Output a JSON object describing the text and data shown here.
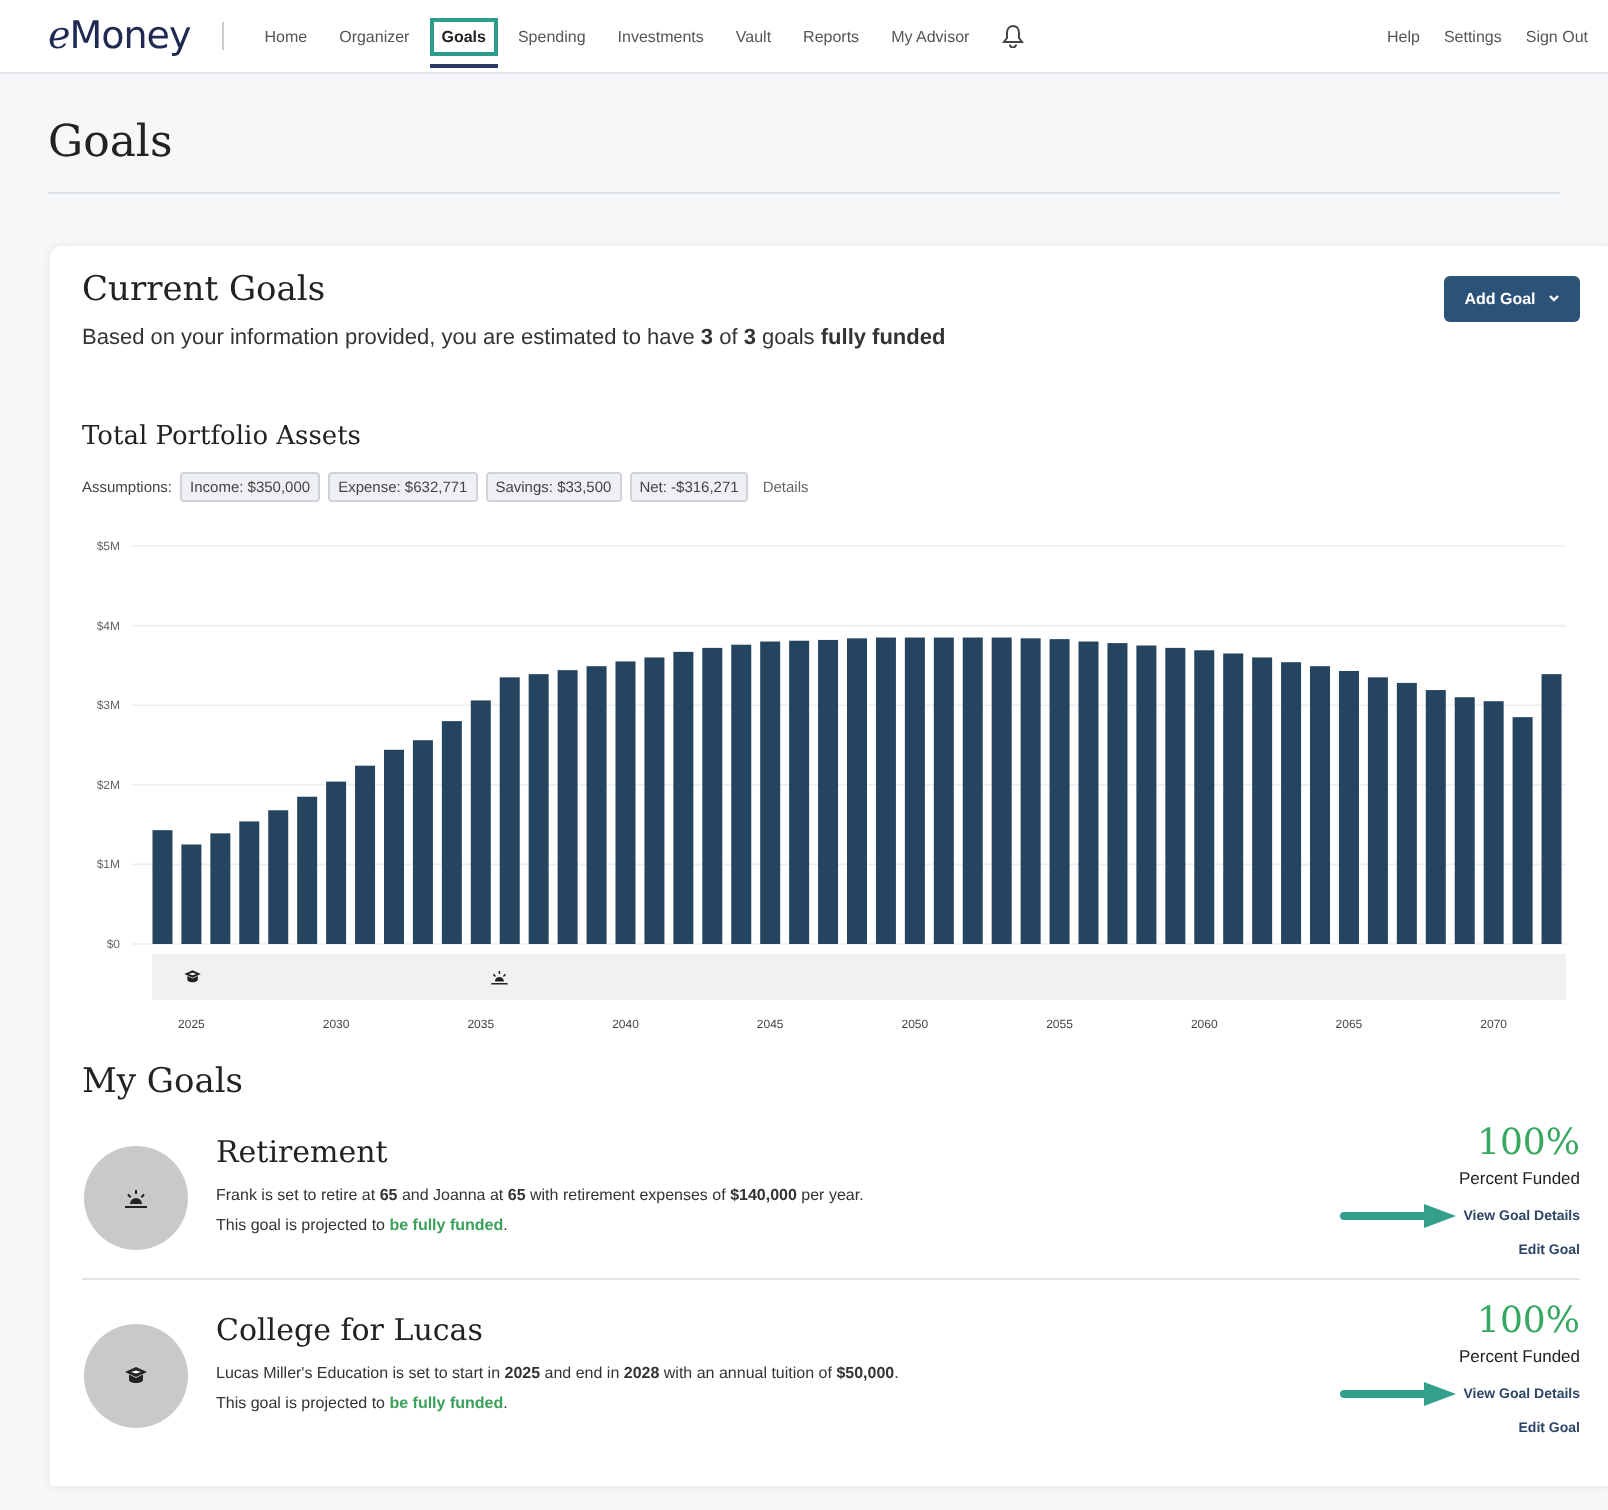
{
  "nav": {
    "logo": "eMoney",
    "items": [
      {
        "label": "Home",
        "selected": false
      },
      {
        "label": "Organizer",
        "selected": false
      },
      {
        "label": "Goals",
        "selected": true
      },
      {
        "label": "Spending",
        "selected": false
      },
      {
        "label": "Investments",
        "selected": false
      },
      {
        "label": "Vault",
        "selected": false
      },
      {
        "label": "Reports",
        "selected": false
      },
      {
        "label": "My Advisor",
        "selected": false
      }
    ],
    "right_links": [
      "Help",
      "Settings",
      "Sign Out"
    ]
  },
  "page_title": "Goals",
  "current_goals": {
    "title": "Current Goals",
    "summary": "Based on your information provided, you are estimated to have **3** of **3** goals **fully funded**",
    "add_button": "Add Goal"
  },
  "portfolio": {
    "title": "Total Portfolio Assets",
    "assumptions_label": "Assumptions:",
    "assumptions": [
      "Income: $350,000",
      "Expense: $632,771",
      "Savings: $33,500",
      "Net: -$316,271"
    ],
    "details_link": "Details",
    "chart_data": {
      "type": "bar",
      "grid": true,
      "xlim": [
        2023.5,
        2072.5
      ],
      "x": [
        2024,
        2025,
        2026,
        2027,
        2028,
        2029,
        2030,
        2031,
        2032,
        2033,
        2034,
        2035,
        2036,
        2037,
        2038,
        2039,
        2040,
        2041,
        2042,
        2043,
        2044,
        2045,
        2046,
        2047,
        2048,
        2049,
        2050,
        2051,
        2052,
        2053,
        2054,
        2055,
        2056,
        2057,
        2058,
        2059,
        2060,
        2061,
        2062,
        2063,
        2064,
        2065,
        2066,
        2067,
        2068,
        2069,
        2070,
        2071,
        2072
      ],
      "series": [
        {
          "color": "#25445f",
          "values": [
            1.43,
            1.25,
            1.39,
            1.54,
            1.68,
            1.85,
            2.04,
            2.24,
            2.44,
            2.56,
            2.8,
            3.06,
            3.35,
            3.39,
            3.44,
            3.49,
            3.55,
            3.6,
            3.67,
            3.72,
            3.76,
            3.8,
            3.81,
            3.82,
            3.84,
            3.85,
            3.85,
            3.85,
            3.85,
            3.85,
            3.84,
            3.83,
            3.8,
            3.78,
            3.75,
            3.72,
            3.69,
            3.65,
            3.6,
            3.54,
            3.49,
            3.43,
            3.35,
            3.28,
            3.19,
            3.1,
            3.05,
            2.85,
            3.39
          ]
        }
      ],
      "ylim": [
        0,
        5
      ],
      "yticks": [
        {
          "value": 0,
          "label": "$0"
        },
        {
          "value": 1,
          "label": "$1M"
        },
        {
          "value": 2,
          "label": "$2M"
        },
        {
          "value": 3,
          "label": "$3M"
        },
        {
          "value": 4,
          "label": "$4M"
        },
        {
          "value": 5,
          "label": "$5M"
        }
      ],
      "xticks": [
        2025,
        2030,
        2035,
        2040,
        2045,
        2050,
        2055,
        2060,
        2065,
        2070
      ]
    },
    "milestones": [
      {
        "kind": "education",
        "level": 0.028
      },
      {
        "kind": "retirement",
        "level": 0.245
      }
    ]
  },
  "my_goals": {
    "title": "My Goals",
    "goals": [
      {
        "kind": "retirement",
        "title": "Retirement",
        "description": "Frank is set to retire at **65** and Joanna at **65** with retirement expenses of **$140,000** per year.",
        "status": "This goal is projected to **be fully funded**.",
        "percent": "100%",
        "percent_label": "Percent Funded",
        "view_link": "View Goal Details",
        "edit_link": "Edit Goal",
        "pointer_arrow": true
      },
      {
        "kind": "education",
        "title": "College for Lucas",
        "description": "Lucas Miller's Education is set to start in **2025** and end in **2028** with an annual tuition of **$50,000**.",
        "status": "This goal is projected to **be fully funded**.",
        "percent": "100%",
        "percent_label": "Percent Funded",
        "view_link": "View Goal Details",
        "edit_link": "Edit Goal",
        "pointer_arrow": true
      }
    ]
  }
}
